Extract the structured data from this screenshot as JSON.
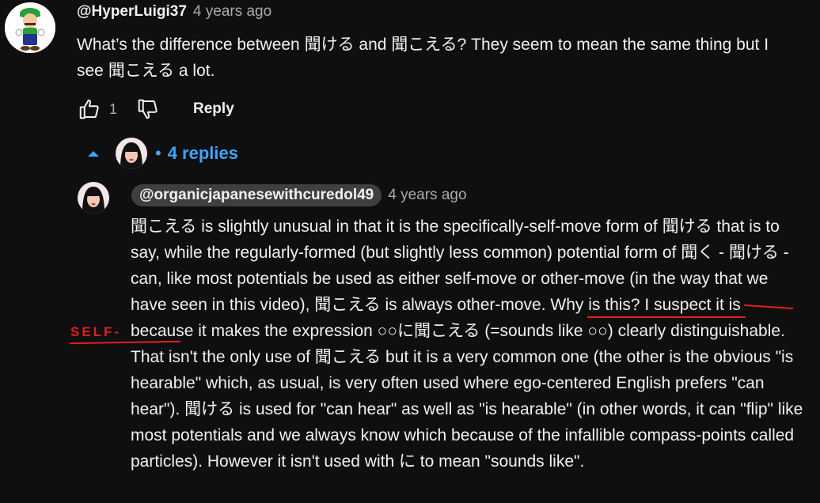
{
  "comment": {
    "author": "@HyperLuigi37",
    "time": "4 years ago",
    "text": "What’s the difference between 聞ける and 聞こえる? They seem to mean the same thing but I see 聞こえる a lot.",
    "like_count": "1",
    "reply_label": "Reply",
    "icons": {
      "like": "thumbs-up-icon",
      "dislike": "thumbs-down-icon"
    }
  },
  "replies": {
    "count_label": "4 replies",
    "dot": "•",
    "chevron_icon": "chevron-up-icon"
  },
  "reply": {
    "author": "@organicjapanesewithcuredol49",
    "time": "4 years ago",
    "text": "聞こえる is slightly unusual in that it is the specifically-self-move form of 聞ける that is to say, while the regularly-formed (but  slightly less common) potential form of 聞く - 聞ける - can, like most potentials be used as either self-move or other-move (in the way that we have seen in this video), 聞こえる is always other-move. Why is this? I suspect it is because it makes the expression ○○に聞こえる (=sounds like ○○) clearly distinguishable. That isn't the only use of 聞こえる but it is a very common one (the other is the obvious \"is hearable\" which, as usual, is very often used where ego-centered English prefers \"can hear\"). 聞ける is used for \"can hear\" as well as \"is hearable\" (in other words, it can \"flip\" like most potentials and we always know which because of the infallible compass-points called particles). However it isn't used with に to mean \"sounds like\"."
  },
  "annotation": {
    "handwritten_text": "SELF-",
    "color": "#e02020"
  },
  "colors": {
    "background": "#0f0f0f",
    "text": "#f1f1f1",
    "muted": "#aaaaaa",
    "link": "#3ea6ff",
    "chip": "#3f3f3f"
  }
}
